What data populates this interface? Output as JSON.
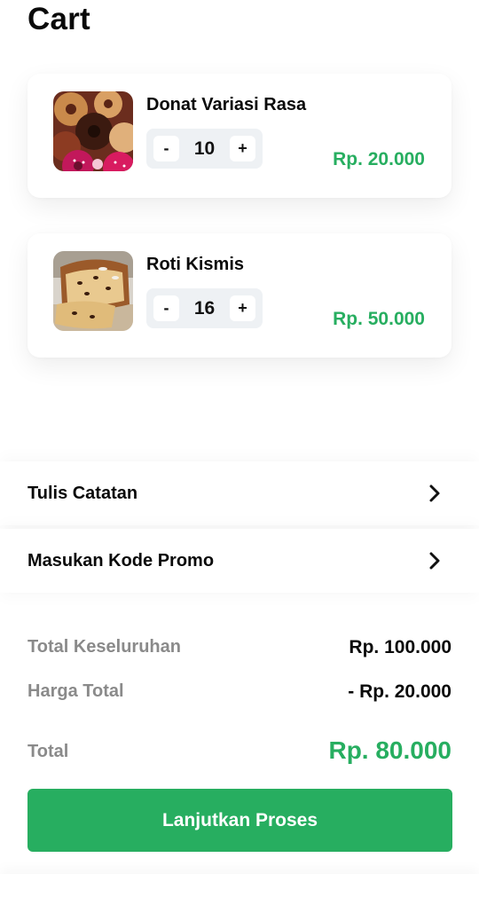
{
  "page": {
    "title": "Cart"
  },
  "cart": {
    "items": [
      {
        "name": "Donat Variasi Rasa",
        "quantity": "10",
        "price": "Rp. 20.000",
        "minus_label": "-",
        "plus_label": "+",
        "image": "donut-image"
      },
      {
        "name": "Roti Kismis",
        "quantity": "16",
        "price": "Rp. 50.000",
        "minus_label": "-",
        "plus_label": "+",
        "image": "raisin-bread-image"
      }
    ]
  },
  "options": {
    "note_label": "Tulis Catatan",
    "promo_label": "Masukan Kode Promo"
  },
  "summary": {
    "grand_total_label": "Total Keseluruhan",
    "grand_total_value": "Rp. 100.000",
    "price_total_label": "Harga Total",
    "price_total_value": "- Rp. 20.000",
    "total_label": "Total",
    "total_value": "Rp. 80.000"
  },
  "actions": {
    "proceed_label": "Lanjutkan Proses"
  },
  "colors": {
    "accent": "#27ae60",
    "muted_text": "#8a8a8a",
    "stepper_bg": "#eef1f4"
  }
}
